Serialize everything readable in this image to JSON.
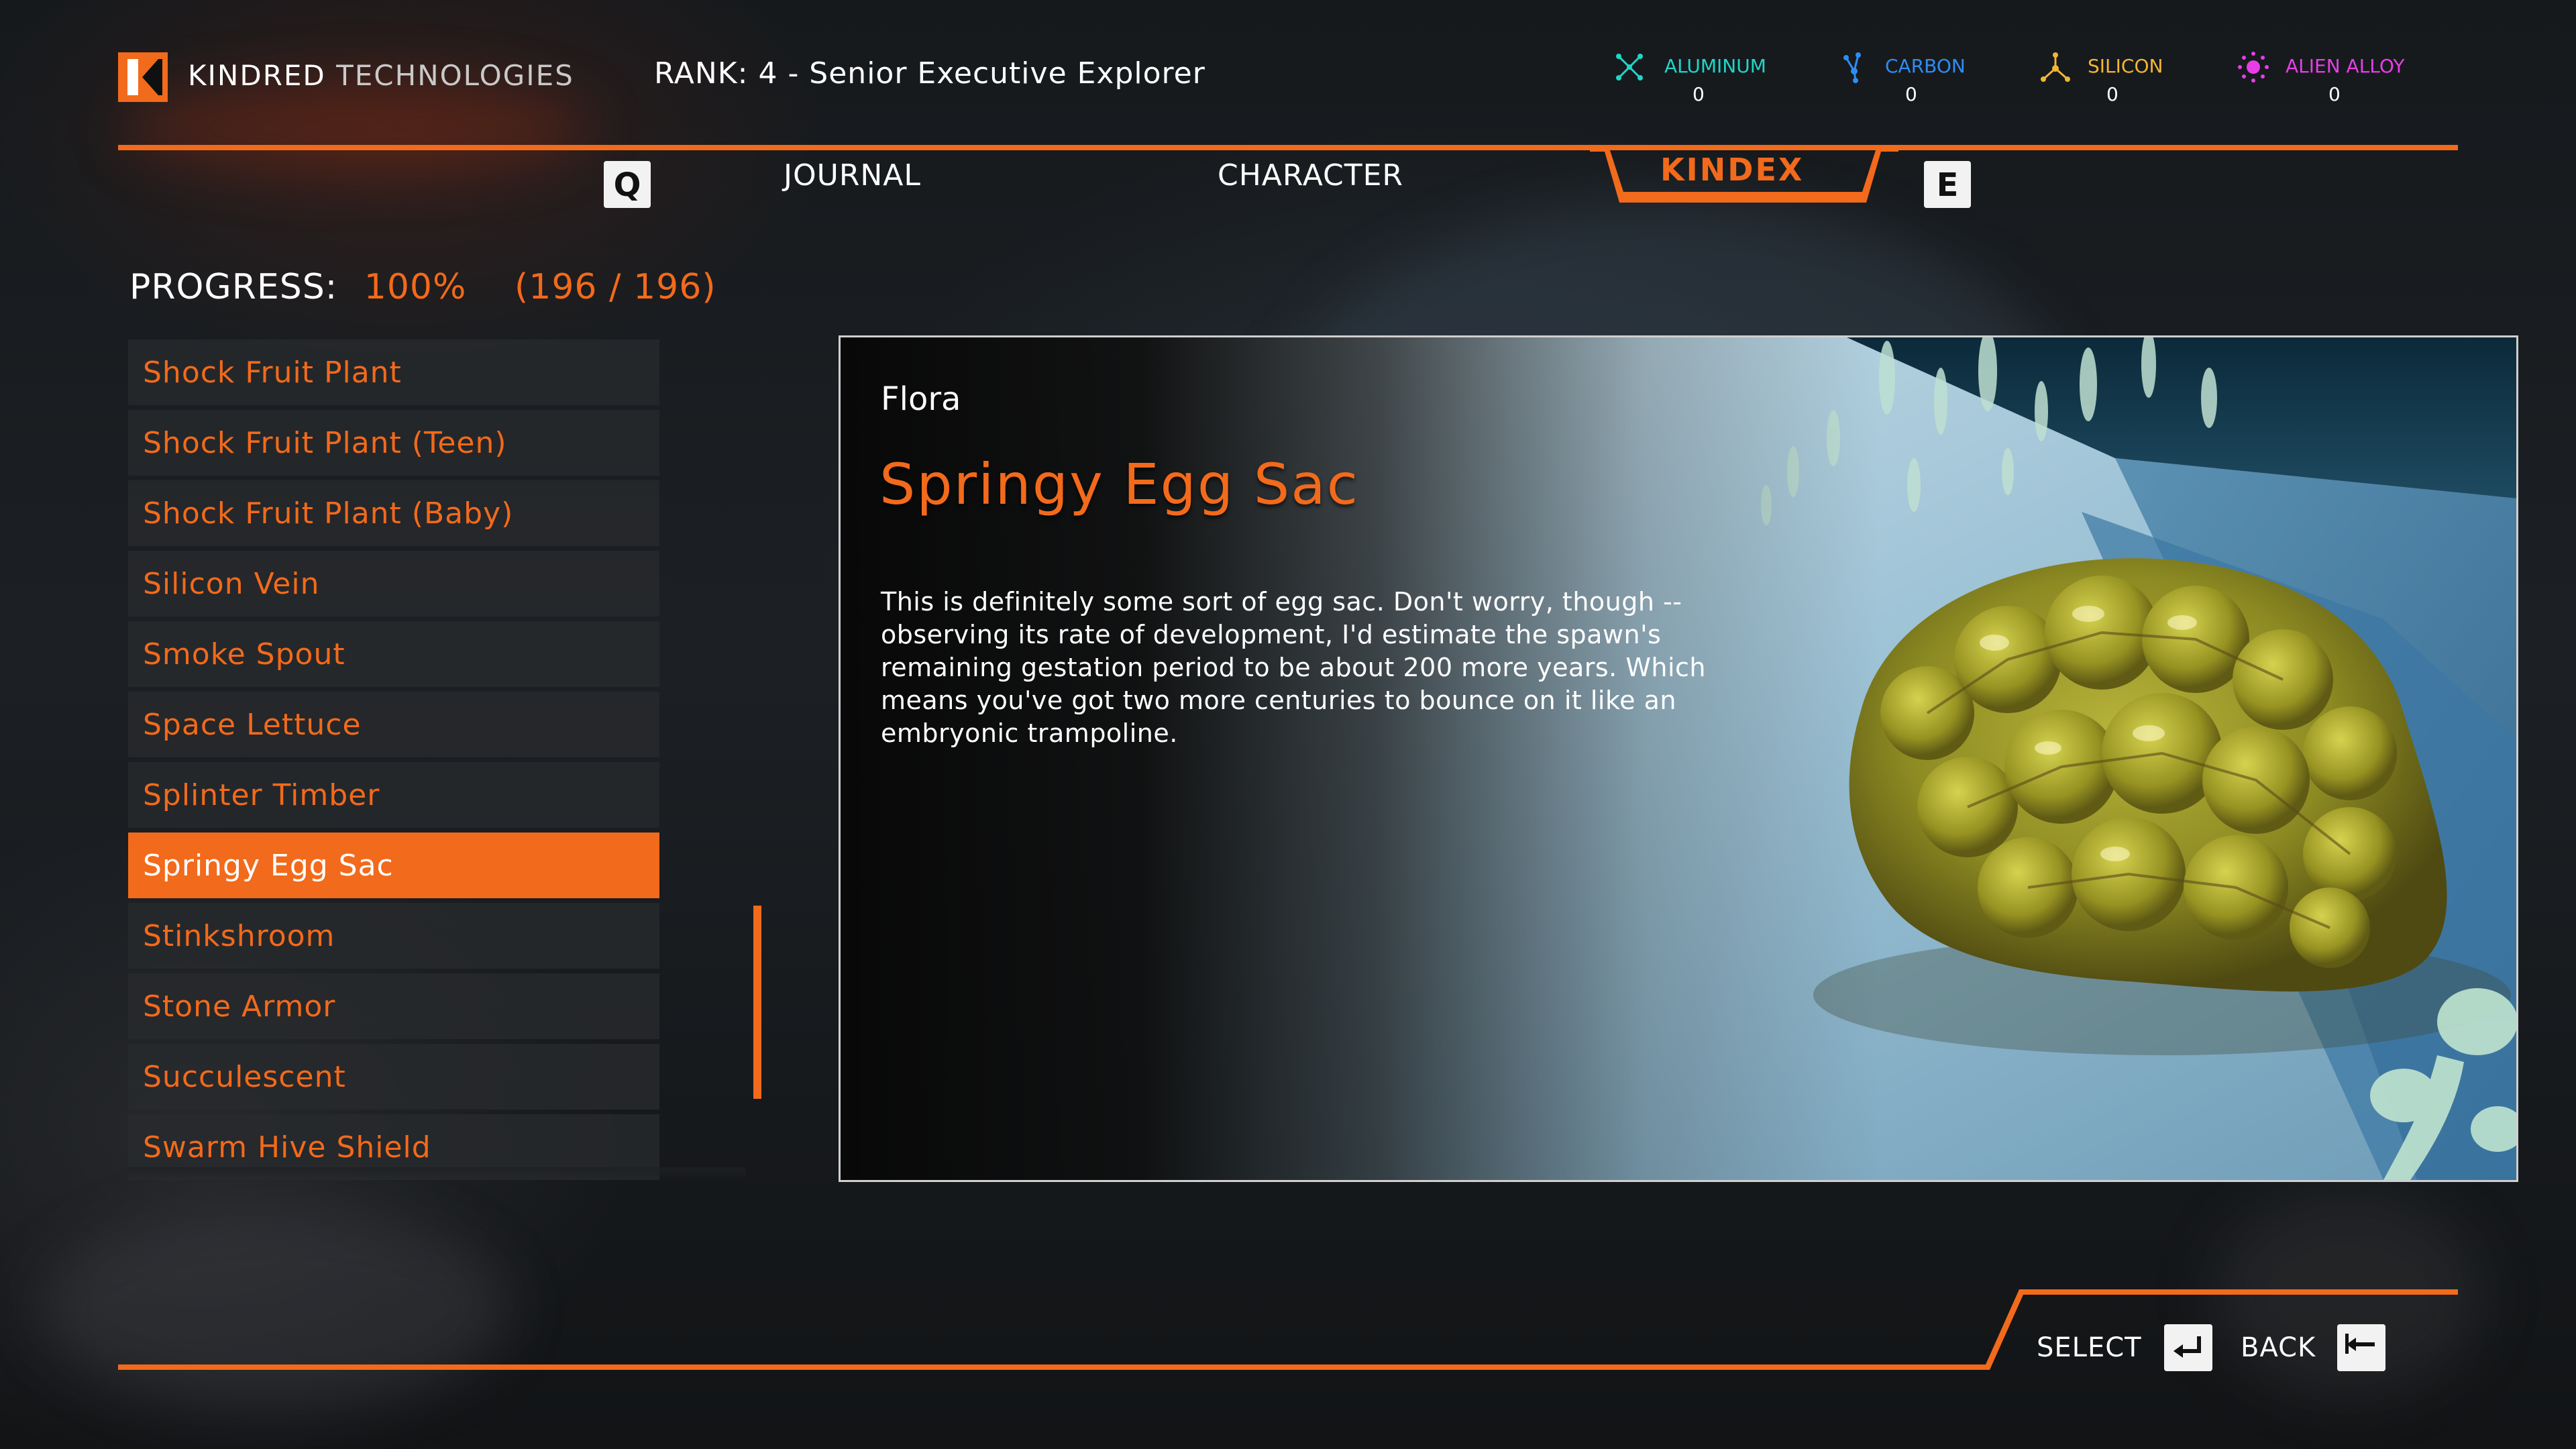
{
  "header": {
    "brand_bold": "KINDRED",
    "brand_light": "TECHNOLOGIES",
    "rank": "RANK: 4 - Senior Executive Explorer"
  },
  "resources": [
    {
      "name": "ALUMINUM",
      "value": "0",
      "color": "#1fd6c9",
      "icon": "aluminum-icon"
    },
    {
      "name": "CARBON",
      "value": "0",
      "color": "#2f8df2",
      "icon": "carbon-icon"
    },
    {
      "name": "SILICON",
      "value": "0",
      "color": "#f2b632",
      "icon": "silicon-icon"
    },
    {
      "name": "ALIEN ALLOY",
      "value": "0",
      "color": "#e83ee8",
      "icon": "alien-alloy-icon"
    }
  ],
  "tabs": {
    "prev_key": "Q",
    "next_key": "E",
    "journal": "JOURNAL",
    "character": "CHARACTER",
    "kindex": "KINDEX"
  },
  "progress": {
    "label": "PROGRESS:",
    "percent": "100%",
    "count": "(196 / 196)"
  },
  "list": {
    "items": [
      "Shock Fruit Plant",
      "Shock Fruit Plant (Teen)",
      "Shock Fruit Plant (Baby)",
      "Silicon Vein",
      "Smoke Spout",
      "Space Lettuce",
      "Splinter Timber",
      "Springy Egg Sac",
      "Stinkshroom",
      "Stone Armor",
      "Succulescent",
      "Swarm Hive Shield"
    ],
    "selected_index": 7
  },
  "detail": {
    "category": "Flora",
    "title": "Springy Egg Sac",
    "description": "This is definitely some sort of egg sac. Don't worry, though -- observing its rate of development, I'd estimate the spawn's remaining gestation period to be about 200 more years. Which means you've got two more centuries to bounce on it like an embryonic trampoline."
  },
  "footer": {
    "select_label": "SELECT",
    "back_label": "BACK",
    "select_icon": "enter-key-icon",
    "back_icon": "backspace-key-icon"
  },
  "colors": {
    "accent": "#f26a1b",
    "text": "#ffffff"
  }
}
